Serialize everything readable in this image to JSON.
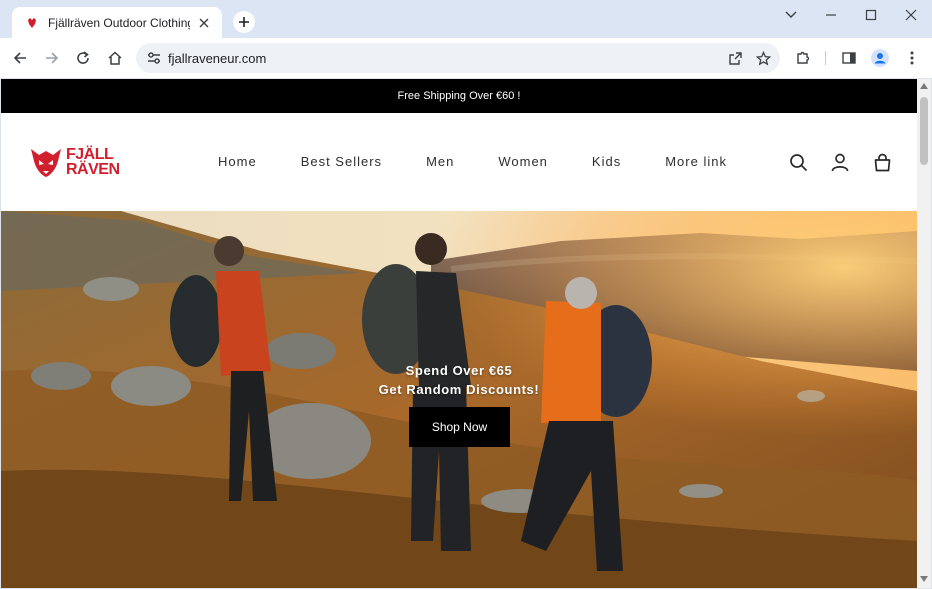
{
  "browser": {
    "tab_title": "Fjällräven Outdoor Clothing & E",
    "url": "fjallraveneur.com"
  },
  "icons": {
    "favicon": "fox-favicon-icon",
    "tab_close": "close-icon",
    "new_tab": "plus-icon",
    "back": "arrow-left-icon",
    "forward": "arrow-right-icon",
    "reload": "reload-icon",
    "home": "home-icon",
    "site_info": "tune-icon",
    "share": "share-icon",
    "bookmark": "star-icon",
    "extensions": "puzzle-icon",
    "side_panel": "side-panel-icon",
    "profile": "profile-icon",
    "menu": "kebab-menu-icon",
    "search": "search-icon",
    "account": "user-icon",
    "cart": "bag-icon"
  },
  "announcement": "Free Shipping Over €60 !",
  "logo": {
    "line1": "FJÄLL",
    "line2": "RÄVEN"
  },
  "nav": [
    "Home",
    "Best Sellers",
    "Men",
    "Women",
    "Kids",
    "More link"
  ],
  "hero": {
    "line1": "Spend Over €65",
    "line2": "Get Random Discounts!",
    "button": "Shop Now"
  },
  "colors": {
    "brand_red": "#d11f2e",
    "announce_bg": "#000000",
    "button_bg": "#000000"
  }
}
